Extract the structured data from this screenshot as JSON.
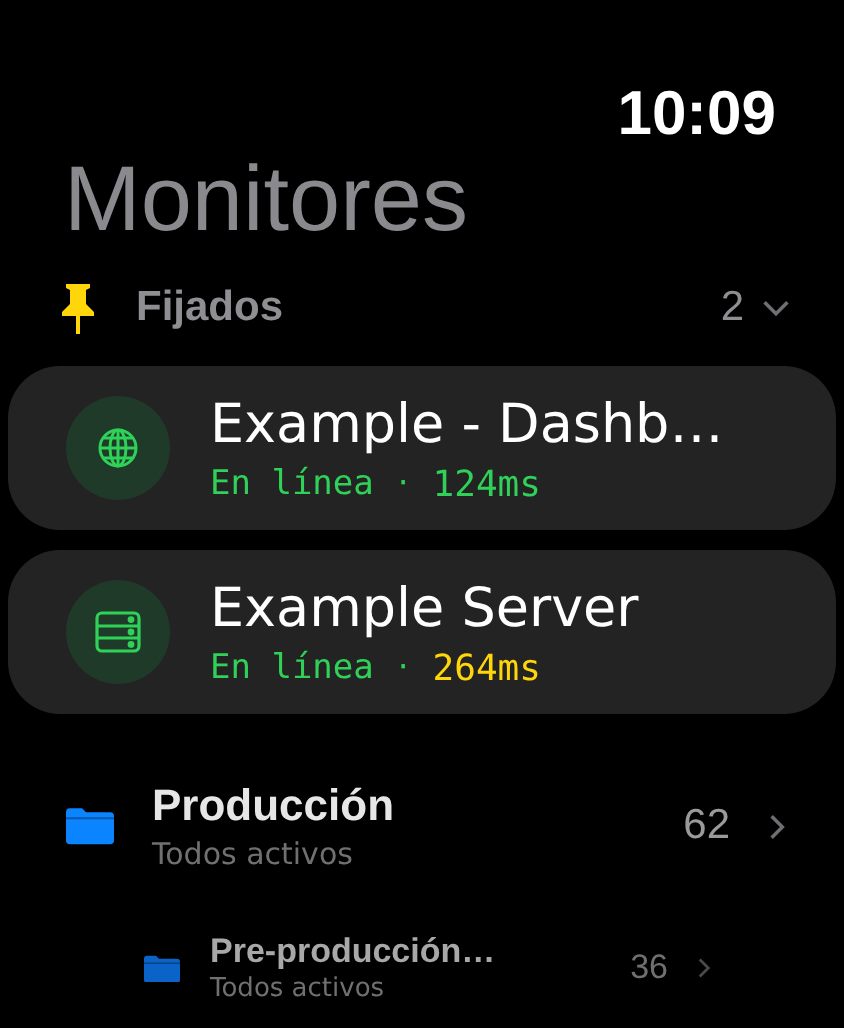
{
  "status_bar": {
    "time": "10:09"
  },
  "title": "Monitores",
  "pinned": {
    "label": "Fijados",
    "count": "2",
    "expanded": true,
    "monitors": [
      {
        "kind": "web",
        "name": "Example - Dashb…",
        "status": "En línea",
        "separator": "·",
        "latency": "124ms",
        "color": "#30d158"
      },
      {
        "kind": "server",
        "name": "Example Server",
        "status": "En línea",
        "separator": "·",
        "latency": "264ms",
        "color": "#ffd60a"
      }
    ]
  },
  "groups": [
    {
      "kind": "main",
      "name": "Producción",
      "subtitle": "Todos activos",
      "count": "62"
    },
    {
      "kind": "nested",
      "name": "Pre-producción…",
      "subtitle": "Todos activos",
      "count": "36"
    }
  ]
}
